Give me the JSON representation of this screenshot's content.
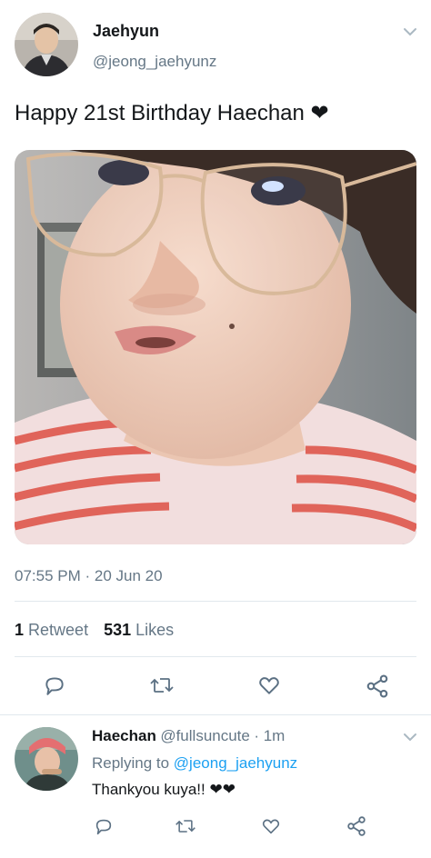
{
  "tweet": {
    "author_name": "Jaehyun",
    "author_handle": "@jeong_jaehyunz",
    "text": "Happy 21st Birthday Haechan ❤",
    "time": "07:55 PM · 20 Jun 20",
    "retweet_count": "1",
    "retweet_label": "Retweet",
    "like_count": "531",
    "like_label": "Likes"
  },
  "reply": {
    "author_name": "Haechan",
    "author_handle": "@fullsuncute",
    "age": "· 1m",
    "replying_prefix": "Replying to",
    "replying_handle": "@jeong_jaehyunz",
    "text": "Thankyou kuya!! ❤❤"
  },
  "colors": {
    "accent": "#1da1f2",
    "secondary_text": "#657786",
    "divider": "#e1e8ed",
    "icon": "#5b7083"
  },
  "icons": {
    "reply": "reply-icon",
    "retweet": "retweet-icon",
    "like": "heart-icon",
    "share": "share-icon",
    "menu": "chevron-down-icon"
  }
}
